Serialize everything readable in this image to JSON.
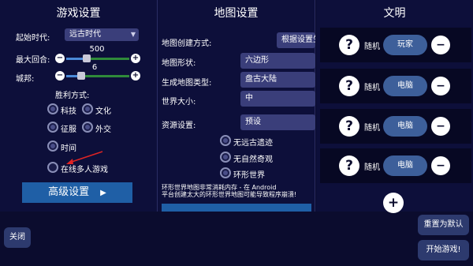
{
  "game": {
    "title": "游戏设置",
    "start_era_label": "起始时代:",
    "start_era_value": "远古时代",
    "max_turns_label": "最大回合:",
    "max_turns_value": "500",
    "city_states_label": "城邦:",
    "city_states_value": "6",
    "victory_label": "胜利方式:",
    "victories": [
      "科技",
      "文化",
      "征服",
      "外交",
      "时间"
    ],
    "online_label": "在线多人游戏",
    "advanced_label": "高级设置"
  },
  "map": {
    "title": "地图设置",
    "creation_label": "地图创建方式:",
    "creation_value": "根据设置生",
    "shape_label": "地图形状:",
    "shape_value": "六边形",
    "type_label": "生成地图类型:",
    "type_value": "盘古大陆",
    "size_label": "世界大小:",
    "size_value": "中",
    "resource_label": "资源设置:",
    "resource_value": "预设",
    "options": [
      "无远古遗迹",
      "无自然奇观",
      "环形世界"
    ],
    "warning_line1": "环形世界地图非常消耗内存 - 在 Android",
    "warning_line2": "平台创建太大的环形世界地图可能导致程序崩溃!"
  },
  "civ": {
    "title": "文明",
    "rows": [
      {
        "random": "随机",
        "player": "玩家"
      },
      {
        "random": "随机",
        "player": "电脑"
      },
      {
        "random": "随机",
        "player": "电脑"
      },
      {
        "random": "随机",
        "player": "电脑"
      }
    ]
  },
  "bottom": {
    "close": "关闭",
    "reset": "重置为默认",
    "start": "开始游戏!"
  }
}
